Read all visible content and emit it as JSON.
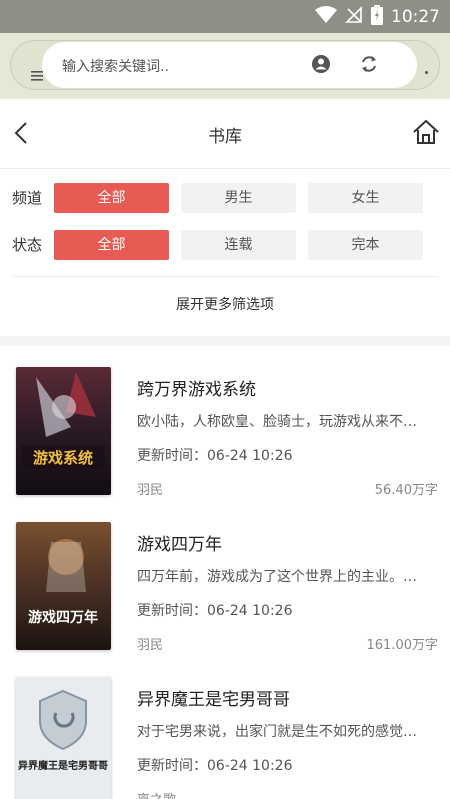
{
  "status_bar": {
    "time": "10:27"
  },
  "browser": {
    "search_placeholder": "输入搜索关键词.."
  },
  "header": {
    "title": "书库"
  },
  "filters": {
    "channel": {
      "label": "频道",
      "options": [
        "全部",
        "男生",
        "女生"
      ],
      "selected": "全部"
    },
    "status": {
      "label": "状态",
      "options": [
        "全部",
        "连载",
        "完本"
      ],
      "selected": "全部"
    },
    "expand_label": "展开更多筛选项"
  },
  "books": [
    {
      "title": "跨万界游戏系统",
      "desc": "欧小陆，人称欧皇、脸骑士，玩游戏从来不…",
      "update": "更新时间：06-24 10:26",
      "author": "羽民",
      "words": "56.40万字",
      "cover_text": "游戏系统",
      "cover_color": "#3a1f2a"
    },
    {
      "title": "游戏四万年",
      "desc": "四万年前，游戏成为了这个世界上的主业。…",
      "update": "更新时间：06-24 10:26",
      "author": "羽民",
      "words": "161.00万字",
      "cover_text": "游戏四万年",
      "cover_color": "#5a3a28"
    },
    {
      "title": "异界魔王是宅男哥哥",
      "desc": "对于宅男来说，出家门就是生不如死的感觉…",
      "update": "更新时间：06-24 10:26",
      "author": "离之歌",
      "words": "",
      "cover_text": "异界魔王是宅男哥哥",
      "cover_color": "#e8ecef"
    }
  ],
  "colors": {
    "accent": "#e85a54",
    "status_bar": "#8e9088",
    "browser_bar": "#e4e8d5"
  }
}
